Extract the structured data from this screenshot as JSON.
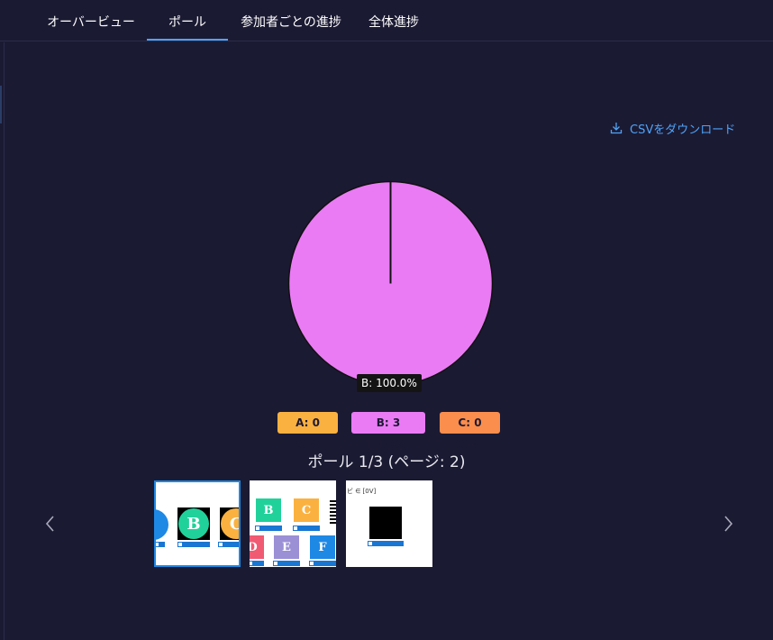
{
  "tabs": [
    {
      "label": "オーバービュー"
    },
    {
      "label": "ポール"
    },
    {
      "label": "参加者ごとの進捗"
    },
    {
      "label": "全体進捗"
    }
  ],
  "active_tab": "ポール",
  "csv_download_label": "CSVをダウンロード",
  "pie_tooltip": "B: 100.0%",
  "legend": [
    {
      "label": "A: 0 (0%)",
      "color": "#fbb140"
    },
    {
      "label": "B: 3 (100%)",
      "color": "#ea7bf5"
    },
    {
      "label": "C: 0 (0%)",
      "color": "#fb8e4d"
    }
  ],
  "poll_title": "ポール 1/3 (ページ: 2)",
  "thumbnails": {
    "thumb1": {
      "letters": [
        "B",
        "C"
      ]
    },
    "thumb2": {
      "letters": [
        "B",
        "C",
        "D",
        "E",
        "F"
      ]
    },
    "thumb3": {
      "header": "ビ ∈ [0V]"
    }
  },
  "colors": {
    "background": "#1b1a33",
    "accent": "#4fa3f7",
    "pie_slice": "#ea7bf5"
  },
  "chart_data": {
    "type": "pie",
    "categories": [
      "A",
      "B",
      "C"
    ],
    "values": [
      0,
      3,
      0
    ],
    "percentages": [
      0,
      100,
      0
    ],
    "colors": [
      "#fbb140",
      "#ea7bf5",
      "#fb8e4d"
    ],
    "tooltip": "B: 100.0%"
  }
}
